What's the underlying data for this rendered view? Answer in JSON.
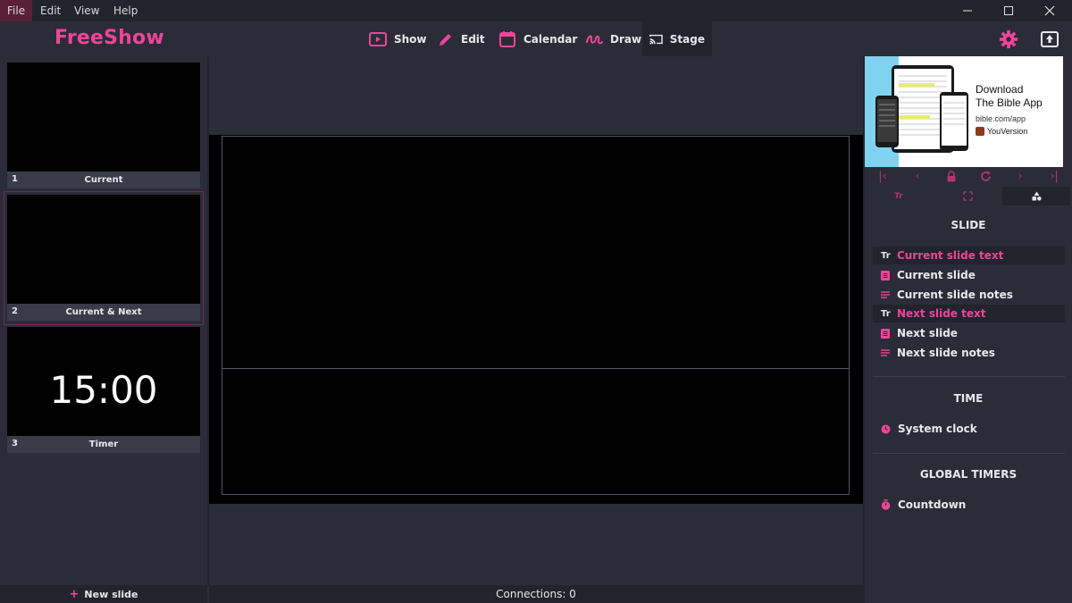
{
  "menu": {
    "file": "File",
    "edit": "Edit",
    "view": "View",
    "help": "Help"
  },
  "app": {
    "logo": "FreeShow"
  },
  "nav": {
    "show": "Show",
    "edit": "Edit",
    "calendar": "Calendar",
    "draw": "Draw",
    "stage": "Stage"
  },
  "slides": [
    {
      "num": "1",
      "name": "Current",
      "content": ""
    },
    {
      "num": "2",
      "name": "Current & Next",
      "content": ""
    },
    {
      "num": "3",
      "name": "Timer",
      "content": "15:00"
    }
  ],
  "left": {
    "new_slide": "New slide"
  },
  "status": {
    "connections": "Connections: 0"
  },
  "ad": {
    "line1": "Download",
    "line2": "The Bible App",
    "url": "bible.com/app",
    "brand": "YouVersion"
  },
  "sections": {
    "slide": "SLIDE",
    "time": "TIME",
    "global_timers": "GLOBAL TIMERS"
  },
  "items": {
    "current_slide_text": "Current slide text",
    "current_slide": "Current slide",
    "current_slide_notes": "Current slide notes",
    "next_slide_text": "Next slide text",
    "next_slide": "Next slide",
    "next_slide_notes": "Next slide notes",
    "system_clock": "System clock",
    "countdown": "Countdown"
  },
  "icons": {
    "text_icon": "Tr"
  },
  "colors": {
    "accent": "#f0449a",
    "bg": "#2b2c38",
    "dark": "#22232d"
  }
}
